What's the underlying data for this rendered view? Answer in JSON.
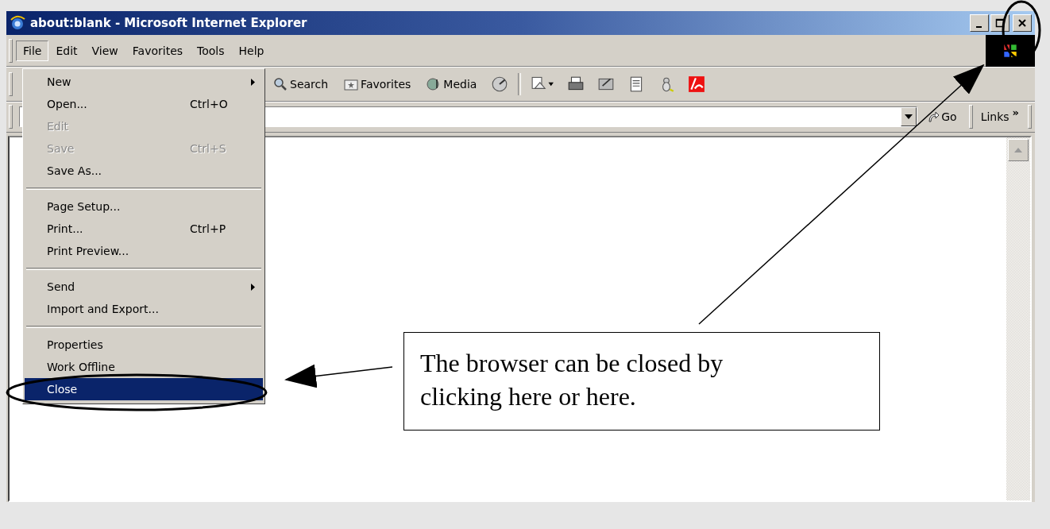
{
  "window": {
    "title": "about:blank - Microsoft Internet Explorer"
  },
  "menu_bar": [
    {
      "label": "File",
      "selected": true
    },
    {
      "label": "Edit",
      "selected": false
    },
    {
      "label": "View",
      "selected": false
    },
    {
      "label": "Favorites",
      "selected": false
    },
    {
      "label": "Tools",
      "selected": false
    },
    {
      "label": "Help",
      "selected": false
    }
  ],
  "file_menu": [
    {
      "kind": "item",
      "label": "New",
      "submenu": true,
      "disabled": false,
      "selected": false
    },
    {
      "kind": "item",
      "label": "Open...",
      "shortcut": "Ctrl+O",
      "disabled": false,
      "selected": false
    },
    {
      "kind": "item",
      "label": "Edit",
      "disabled": true,
      "selected": false
    },
    {
      "kind": "item",
      "label": "Save",
      "shortcut": "Ctrl+S",
      "disabled": true,
      "selected": false
    },
    {
      "kind": "item",
      "label": "Save As...",
      "disabled": false,
      "selected": false
    },
    {
      "kind": "separator"
    },
    {
      "kind": "item",
      "label": "Page Setup...",
      "disabled": false,
      "selected": false
    },
    {
      "kind": "item",
      "label": "Print...",
      "shortcut": "Ctrl+P",
      "disabled": false,
      "selected": false
    },
    {
      "kind": "item",
      "label": "Print Preview...",
      "disabled": false,
      "selected": false
    },
    {
      "kind": "separator"
    },
    {
      "kind": "item",
      "label": "Send",
      "submenu": true,
      "disabled": false,
      "selected": false
    },
    {
      "kind": "item",
      "label": "Import and Export...",
      "disabled": false,
      "selected": false
    },
    {
      "kind": "separator"
    },
    {
      "kind": "item",
      "label": "Properties",
      "disabled": false,
      "selected": false
    },
    {
      "kind": "item",
      "label": "Work Offline",
      "disabled": false,
      "selected": false
    },
    {
      "kind": "item",
      "label": "Close",
      "disabled": false,
      "selected": true
    }
  ],
  "toolbar": [
    {
      "kind": "search",
      "label": "Search"
    },
    {
      "kind": "favorites",
      "label": "Favorites"
    },
    {
      "kind": "media",
      "label": "Media"
    }
  ],
  "address_bar": {
    "go": "Go",
    "links": "Links",
    "links_more": "»"
  },
  "callout": {
    "text": "The browser can be closed by clicking here or here."
  }
}
